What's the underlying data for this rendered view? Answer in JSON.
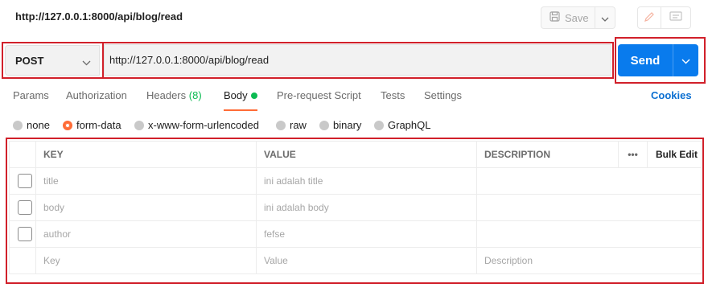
{
  "header": {
    "title": "http://127.0.0.1:8000/api/blog/read",
    "save_label": "Save"
  },
  "request": {
    "method": "POST",
    "url": "http://127.0.0.1:8000/api/blog/read",
    "send_label": "Send"
  },
  "tabs": {
    "params": "Params",
    "authorization": "Authorization",
    "headers": "Headers",
    "headers_count": "(8)",
    "body": "Body",
    "prerequest": "Pre-request Script",
    "tests": "Tests",
    "settings": "Settings",
    "cookies": "Cookies",
    "active": "Body"
  },
  "body_types": {
    "none": "none",
    "form_data": "form-data",
    "urlencoded": "x-www-form-urlencoded",
    "raw": "raw",
    "binary": "binary",
    "graphql": "GraphQL",
    "selected": "form-data"
  },
  "table": {
    "headers": {
      "key": "KEY",
      "value": "VALUE",
      "description": "DESCRIPTION",
      "more": "•••",
      "bulk_edit": "Bulk Edit"
    },
    "rows": [
      {
        "key": "title",
        "value": "ini adalah title",
        "description": ""
      },
      {
        "key": "body",
        "value": "ini adalah body",
        "description": ""
      },
      {
        "key": "author",
        "value": "fefse",
        "description": ""
      }
    ],
    "placeholder_row": {
      "key": "Key",
      "value": "Value",
      "description": "Description"
    }
  },
  "colors": {
    "send_blue": "#097bed",
    "annotation_red": "#d1202a",
    "active_tab_orange": "#ff6c37",
    "body_dot_green": "#0cbb52"
  }
}
